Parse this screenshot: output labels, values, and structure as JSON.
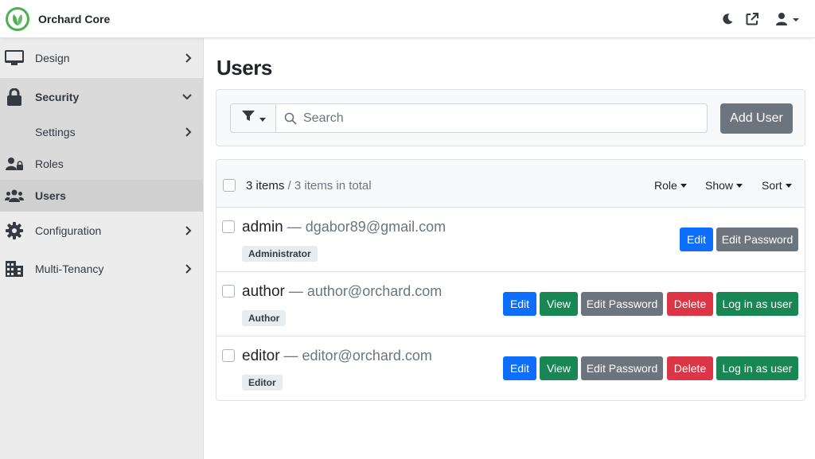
{
  "header": {
    "app_name": "Orchard Core",
    "icons": [
      "theme-toggle-icon",
      "external-link-icon",
      "user-icon"
    ],
    "accent": "#4caf50"
  },
  "sidebar": {
    "items": [
      {
        "label": "Design",
        "icon": "monitor-icon"
      },
      {
        "label": "Security",
        "icon": "lock-icon"
      },
      {
        "label": "Settings"
      },
      {
        "label": "Roles",
        "icon": "user-lock-icon"
      },
      {
        "label": "Users",
        "icon": "users-icon"
      },
      {
        "label": "Configuration",
        "icon": "gear-icon"
      },
      {
        "label": "Multi-Tenancy",
        "icon": "building-icon"
      }
    ]
  },
  "main": {
    "title": "Users",
    "search_placeholder": "Search",
    "add_user_label": "Add User",
    "list_header": {
      "count": "3 items",
      "total": " / 3 items in total",
      "role": "Role",
      "show": "Show",
      "sort": "Sort"
    },
    "users": [
      {
        "name": "admin",
        "email": " — dgabor89@gmail.com",
        "role": "Administrator",
        "edit": "Edit",
        "edit_password": "Edit Password"
      },
      {
        "name": "author",
        "email": " — author@orchard.com",
        "role": "Author",
        "edit": "Edit",
        "view": "View",
        "edit_password": "Edit Password",
        "delete": "Delete",
        "login_as": "Log in as user"
      },
      {
        "name": "editor",
        "email": " — editor@orchard.com",
        "role": "Editor",
        "edit": "Edit",
        "view": "View",
        "edit_password": "Edit Password",
        "delete": "Delete",
        "login_as": "Log in as user"
      }
    ]
  },
  "colors": {
    "primary": "#0d6efd",
    "success": "#198754",
    "secondary": "#6c757d",
    "danger": "#dc3545"
  }
}
